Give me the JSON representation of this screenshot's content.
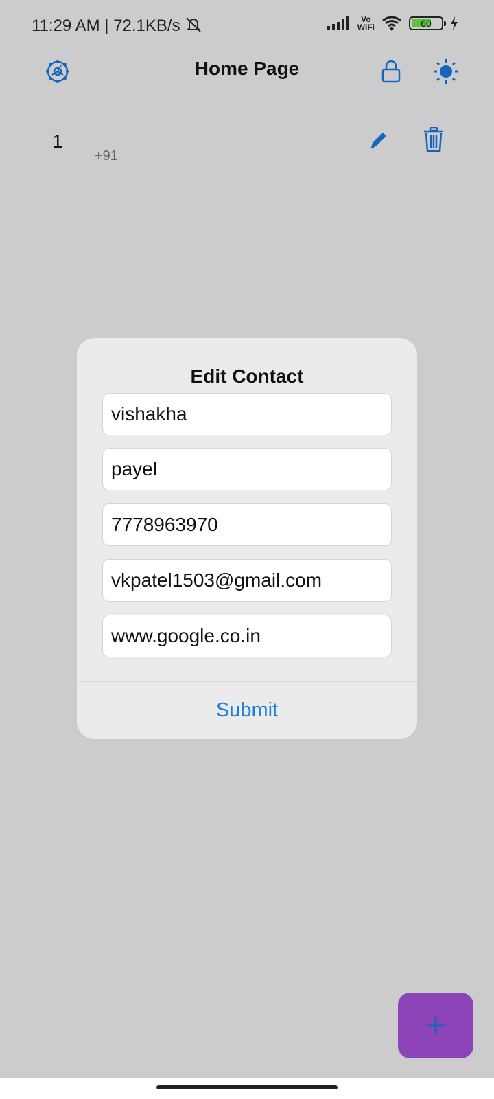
{
  "status_bar": {
    "time_speed": "11:29 AM | 72.1KB/s",
    "network_label_top": "Vo",
    "network_label_bottom": "WiFi",
    "battery_level": "60",
    "battery_fraction": 0.6
  },
  "header": {
    "title": "Home Page",
    "icons": [
      "settings-icon",
      "lock-icon",
      "brightness-icon"
    ],
    "accent_color": "#1565c0"
  },
  "contact_list": [
    {
      "name": "1",
      "phone": "+91"
    }
  ],
  "dialog": {
    "title": "Edit Contact",
    "fields": {
      "first_name": "vishakha",
      "last_name": "payel",
      "phone": "7778963970",
      "email": "vkpatel1503@gmail.com",
      "website": "www.google.co.in"
    },
    "submit_label": "Submit",
    "submit_color": "#1e7fdc"
  },
  "fab": {
    "icon": "plus-icon",
    "color": "#8e44b9"
  }
}
